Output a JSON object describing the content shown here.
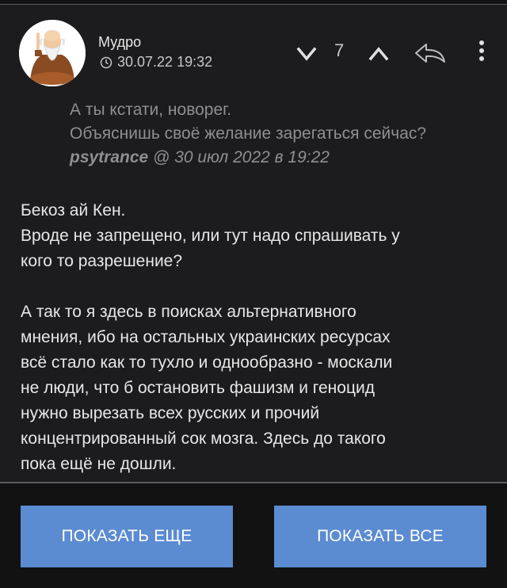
{
  "post": {
    "author": "Мудро",
    "timestamp": "30.07.22 19:32",
    "score": "7",
    "quote": {
      "lines": [
        "А ты кстати, новорег.",
        "Объяснишь своё желание зарегаться сейчас?"
      ],
      "user": "psytrance",
      "date": " @ 30 июл 2022 в 19:22"
    },
    "body": {
      "p1": [
        "Бекоз ай Кен.",
        "Вроде не запрещено, или тут надо спрашивать у",
        "кого то разрешение?"
      ],
      "p2": [
        "А так то я здесь в поисках альтернативного",
        "мнения, ибо на остальных украинских ресурсах",
        "всё стало как то тухло и однообразно - москали",
        "не люди, что б остановить фашизм и геноцид",
        "нужно вырезать всех русских и прочий",
        "концентрированный сок мозга. Здесь до такого",
        "пока ещё не дошли."
      ]
    }
  },
  "buttons": {
    "show_more": "ПОКАЗАТЬ ЕЩЕ",
    "show_all": "ПОКАЗАТЬ ВСЕ"
  },
  "colors": {
    "background": "#121213",
    "card": "#1c1c1e",
    "button": "#5b8bd1",
    "text": "#e7e7e7",
    "muted": "#8f8f92"
  },
  "icons": {
    "clock": "clock-icon",
    "down": "chevron-down-icon",
    "up": "chevron-up-icon",
    "reply": "reply-icon",
    "more": "more-vertical-icon"
  }
}
